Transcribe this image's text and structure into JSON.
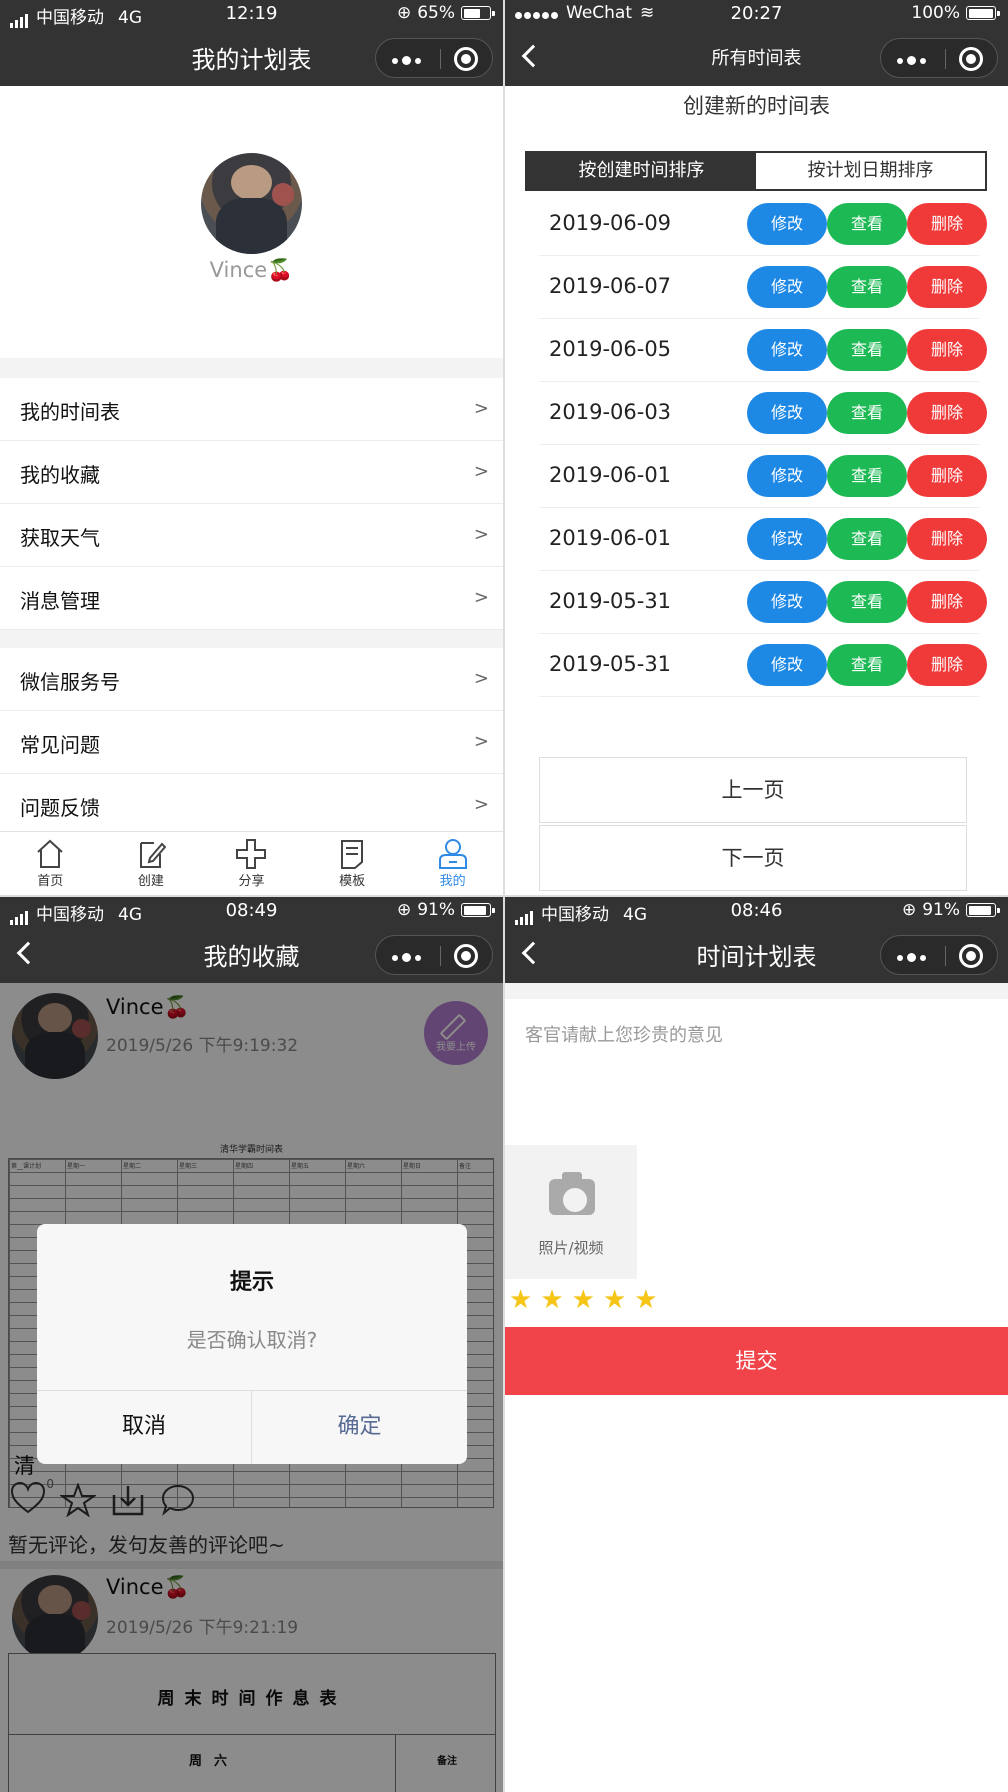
{
  "q1": {
    "status": {
      "carrier": "中国移动",
      "net": "4G",
      "time": "12:19",
      "battery": "65%",
      "battery_level": 0.65
    },
    "title": "我的计划表",
    "user": {
      "name": "Vince🍒"
    },
    "menu1": [
      {
        "label": "我的时间表"
      },
      {
        "label": "我的收藏"
      },
      {
        "label": "获取天气"
      },
      {
        "label": "消息管理"
      }
    ],
    "menu2": [
      {
        "label": "微信服务号"
      },
      {
        "label": "常见问题"
      },
      {
        "label": "问题反馈"
      }
    ],
    "arrow": ">",
    "tabs": [
      {
        "label": "首页",
        "icon": "home-icon"
      },
      {
        "label": "创建",
        "icon": "edit-icon"
      },
      {
        "label": "分享",
        "icon": "plus-icon"
      },
      {
        "label": "模板",
        "icon": "document-icon"
      },
      {
        "label": "我的",
        "icon": "user-icon"
      }
    ],
    "active_color": "#2f8ae6"
  },
  "q2": {
    "status": {
      "carrier": "WeChat",
      "time": "20:27",
      "battery": "100%",
      "battery_level": 1.0
    },
    "title": "所有时间表",
    "create": "创建新的时间表",
    "sort_created": "按创建时间排序",
    "sort_plan": "按计划日期排序",
    "buttons": {
      "edit": "修改",
      "view": "查看",
      "delete": "删除"
    },
    "colors": {
      "edit": "#1e88e5",
      "view": "#1db954",
      "delete": "#f03a3a"
    },
    "rows": [
      {
        "date": "2019-06-09"
      },
      {
        "date": "2019-06-07"
      },
      {
        "date": "2019-06-05"
      },
      {
        "date": "2019-06-03"
      },
      {
        "date": "2019-06-01"
      },
      {
        "date": "2019-06-01"
      },
      {
        "date": "2019-05-31"
      },
      {
        "date": "2019-05-31"
      }
    ],
    "prev": "上一页",
    "next": "下一页"
  },
  "q3": {
    "status": {
      "carrier": "中国移动",
      "net": "4G",
      "time": "08:49",
      "battery": "91%",
      "battery_level": 0.91
    },
    "title": "我的收藏",
    "card1": {
      "name": "Vince🍒",
      "time": "2019/5/26 下午9:19:32"
    },
    "upload": "我要上传",
    "sheet_title": "清华学霸时间表",
    "sheet_heads": [
      "第__课计划",
      "星期一",
      "星期二",
      "星期三",
      "星期四",
      "星期五",
      "星期六",
      "星期日",
      "备注"
    ],
    "qing": "清",
    "like_count": "0",
    "no_comment": "暂无评论，发句友善的评论吧~",
    "card2": {
      "name": "Vince🍒",
      "time": "2019/5/26 下午9:21:19"
    },
    "weekend_title": "周末时间作息表",
    "weekend_col1": "周六",
    "weekend_col2": "备注",
    "dialog": {
      "title": "提示",
      "message": "是否确认取消?",
      "cancel": "取消",
      "ok": "确定"
    }
  },
  "q4": {
    "status": {
      "carrier": "中国移动",
      "net": "4G",
      "time": "08:46",
      "battery": "91%",
      "battery_level": 0.91
    },
    "title": "时间计划表",
    "placeholder": "客官请献上您珍贵的意见",
    "photo_label": "照片/视频",
    "stars": [
      "★",
      "★",
      "★",
      "★",
      "★"
    ],
    "rating": 5,
    "submit": "提交",
    "submit_color": "#f0434a"
  }
}
